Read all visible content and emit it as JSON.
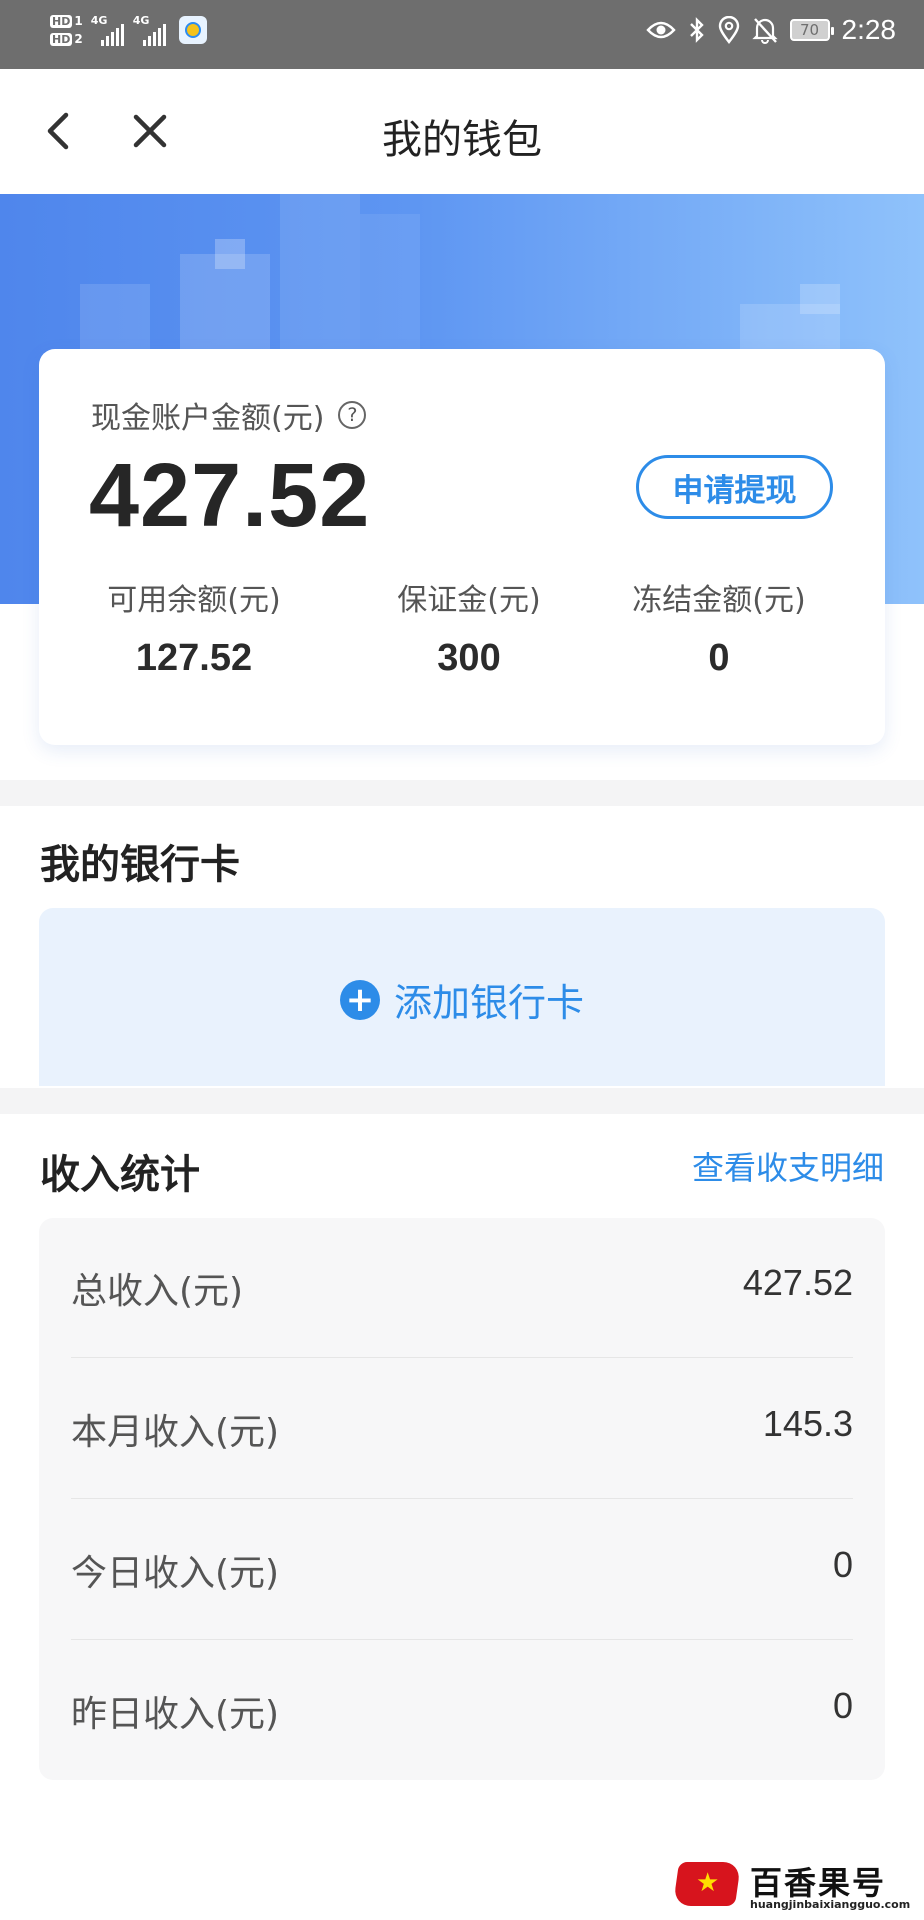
{
  "status_bar": {
    "hd1": "HD",
    "hd1_sub": "1",
    "hd2": "HD",
    "hd2_sub": "2",
    "network1": "4G",
    "network2": "4G",
    "battery": "70",
    "time": "2:28"
  },
  "nav": {
    "title": "我的钱包"
  },
  "balance_card": {
    "cash_label": "现金账户金额(元)",
    "help_icon": "?",
    "cash_amount": "427.52",
    "withdraw_button": "申请提现",
    "stats": [
      {
        "label": "可用余额(元)",
        "value": "127.52"
      },
      {
        "label": "保证金(元)",
        "value": "300"
      },
      {
        "label": "冻结金额(元)",
        "value": "0"
      }
    ]
  },
  "bank_section": {
    "title": "我的银行卡",
    "add_label": "添加银行卡",
    "add_icon": "+"
  },
  "income_section": {
    "title": "收入统计",
    "detail_link": "查看收支明细",
    "rows": [
      {
        "label": "总收入(元)",
        "value": "427.52"
      },
      {
        "label": "本月收入(元)",
        "value": "145.3"
      },
      {
        "label": "今日收入(元)",
        "value": "0"
      },
      {
        "label": "昨日收入(元)",
        "value": "0"
      }
    ]
  },
  "watermark": {
    "text": "百香果号",
    "url": "huangjinbaixiangguo.com",
    "star": "★"
  },
  "colors": {
    "accent": "#2d8ce8",
    "hero_start": "#4f86ec",
    "hero_end": "#8fc2fb",
    "status_bar": "#6e6e6e"
  }
}
